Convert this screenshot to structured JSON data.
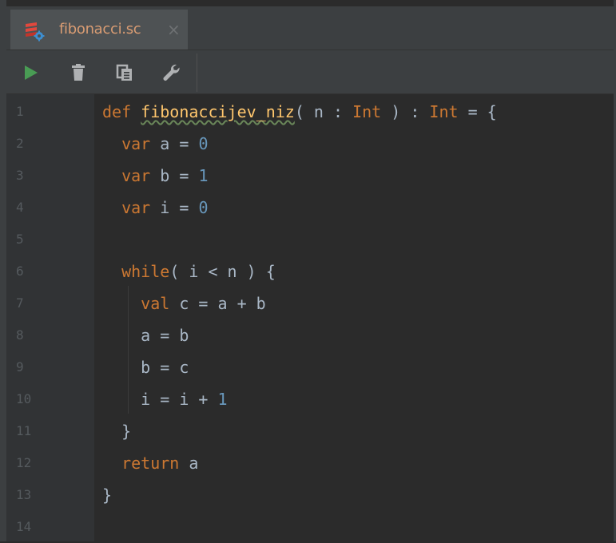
{
  "tab": {
    "label": "fibonacci.sc",
    "close_glyph": "×",
    "icon": "scala-worksheet-icon",
    "accent": "#4a88c7"
  },
  "toolbar": {
    "buttons": [
      {
        "name": "run-button",
        "icon": "play-icon"
      },
      {
        "name": "clear-button",
        "icon": "trash-icon"
      },
      {
        "name": "copy-button",
        "icon": "copy-icon"
      },
      {
        "name": "settings-button",
        "icon": "wrench-icon"
      }
    ]
  },
  "editor": {
    "line_numbers": [
      "1",
      "2",
      "3",
      "4",
      "5",
      "6",
      "7",
      "8",
      "9",
      "10",
      "11",
      "12",
      "13",
      "14"
    ],
    "lines": [
      {
        "segments": [
          [
            "kw",
            "def "
          ],
          [
            "fn",
            "fibonaccijev_niz"
          ],
          [
            "plain",
            "( n : "
          ],
          [
            "ty",
            "Int"
          ],
          [
            "plain",
            " ) : "
          ],
          [
            "ty",
            "Int"
          ],
          [
            "plain",
            " = {"
          ]
        ]
      },
      {
        "segments": [
          [
            "plain",
            "  "
          ],
          [
            "kw",
            "var"
          ],
          [
            "plain",
            " a = "
          ],
          [
            "num",
            "0"
          ]
        ]
      },
      {
        "segments": [
          [
            "plain",
            "  "
          ],
          [
            "kw",
            "var"
          ],
          [
            "plain",
            " b = "
          ],
          [
            "num",
            "1"
          ]
        ]
      },
      {
        "segments": [
          [
            "plain",
            "  "
          ],
          [
            "kw",
            "var"
          ],
          [
            "plain",
            " i = "
          ],
          [
            "num",
            "0"
          ]
        ]
      },
      {
        "segments": []
      },
      {
        "segments": [
          [
            "plain",
            "  "
          ],
          [
            "kw",
            "while"
          ],
          [
            "plain",
            "( i < n ) {"
          ]
        ]
      },
      {
        "segments": [
          [
            "plain",
            "    "
          ],
          [
            "kw",
            "val"
          ],
          [
            "plain",
            " c = a + b"
          ]
        ]
      },
      {
        "segments": [
          [
            "plain",
            "    a = b"
          ]
        ]
      },
      {
        "segments": [
          [
            "plain",
            "    b = c"
          ]
        ]
      },
      {
        "segments": [
          [
            "plain",
            "    i = i + "
          ],
          [
            "num",
            "1"
          ]
        ]
      },
      {
        "segments": [
          [
            "plain",
            "  }"
          ]
        ]
      },
      {
        "segments": [
          [
            "plain",
            "  "
          ],
          [
            "kw",
            "return"
          ],
          [
            "plain",
            " a"
          ]
        ]
      },
      {
        "segments": [
          [
            "plain",
            "}"
          ]
        ]
      },
      {
        "segments": []
      }
    ]
  },
  "colors": {
    "keyword": "#cc7832",
    "number": "#6897bb",
    "function": "#ffc66d",
    "text": "#a9b7c6",
    "gutter_text": "#555a5e",
    "background": "#2b2b2b"
  }
}
